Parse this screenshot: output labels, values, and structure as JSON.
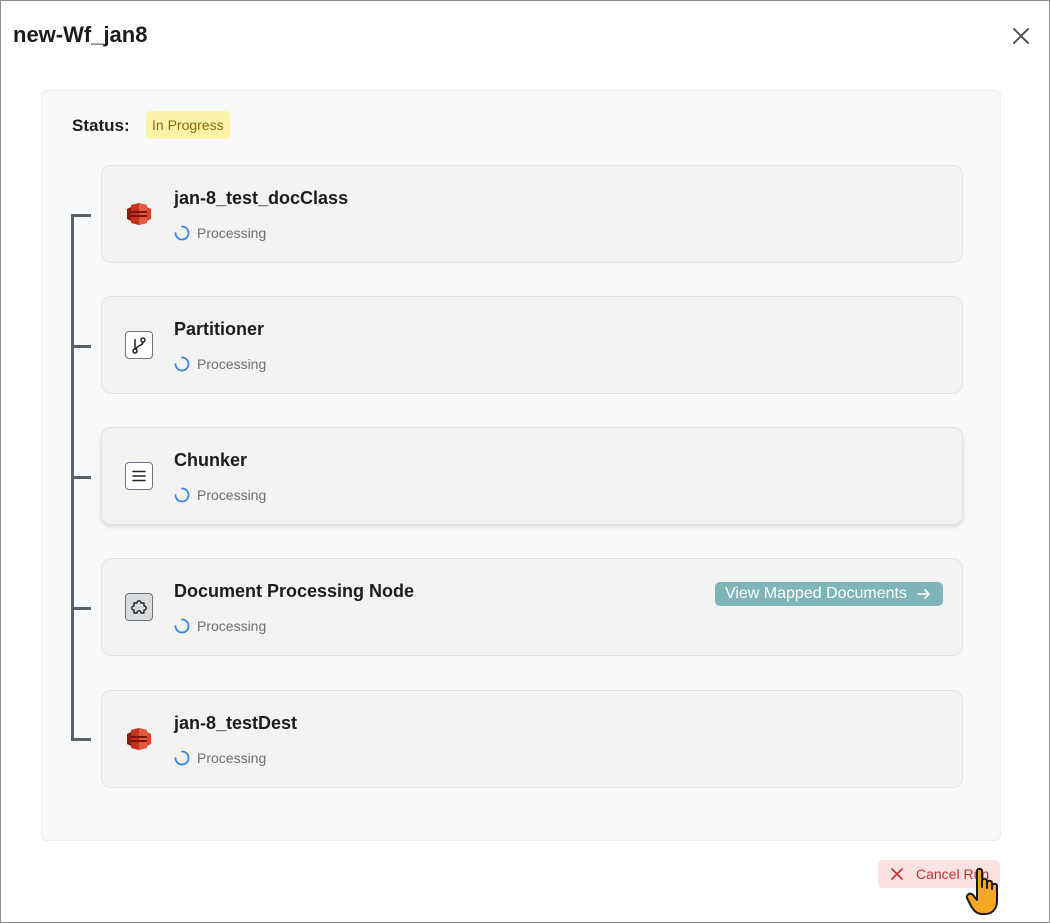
{
  "dialog": {
    "title": "new-Wf_jan8",
    "close_icon": "close-icon"
  },
  "status": {
    "label": "Status:",
    "value": "In Progress",
    "badge_color": "#fdf3a8"
  },
  "nodes": [
    {
      "title": "jan-8_test_docClass",
      "status": "Processing",
      "icon": "aws-s3-icon"
    },
    {
      "title": "Partitioner",
      "status": "Processing",
      "icon": "git-branch-icon"
    },
    {
      "title": "Chunker",
      "status": "Processing",
      "icon": "lines-icon"
    },
    {
      "title": "Document Processing Node",
      "status": "Processing",
      "icon": "puzzle-icon",
      "action": "View Mapped Documents"
    },
    {
      "title": "jan-8_testDest",
      "status": "Processing",
      "icon": "aws-s3-icon"
    }
  ],
  "footer": {
    "cancel_label": "Cancel Run",
    "cancel_color": "#c53030"
  },
  "colors": {
    "spinner": "#3b82f6",
    "action_button": "#7fb5b9",
    "timeline": "#59616e"
  }
}
